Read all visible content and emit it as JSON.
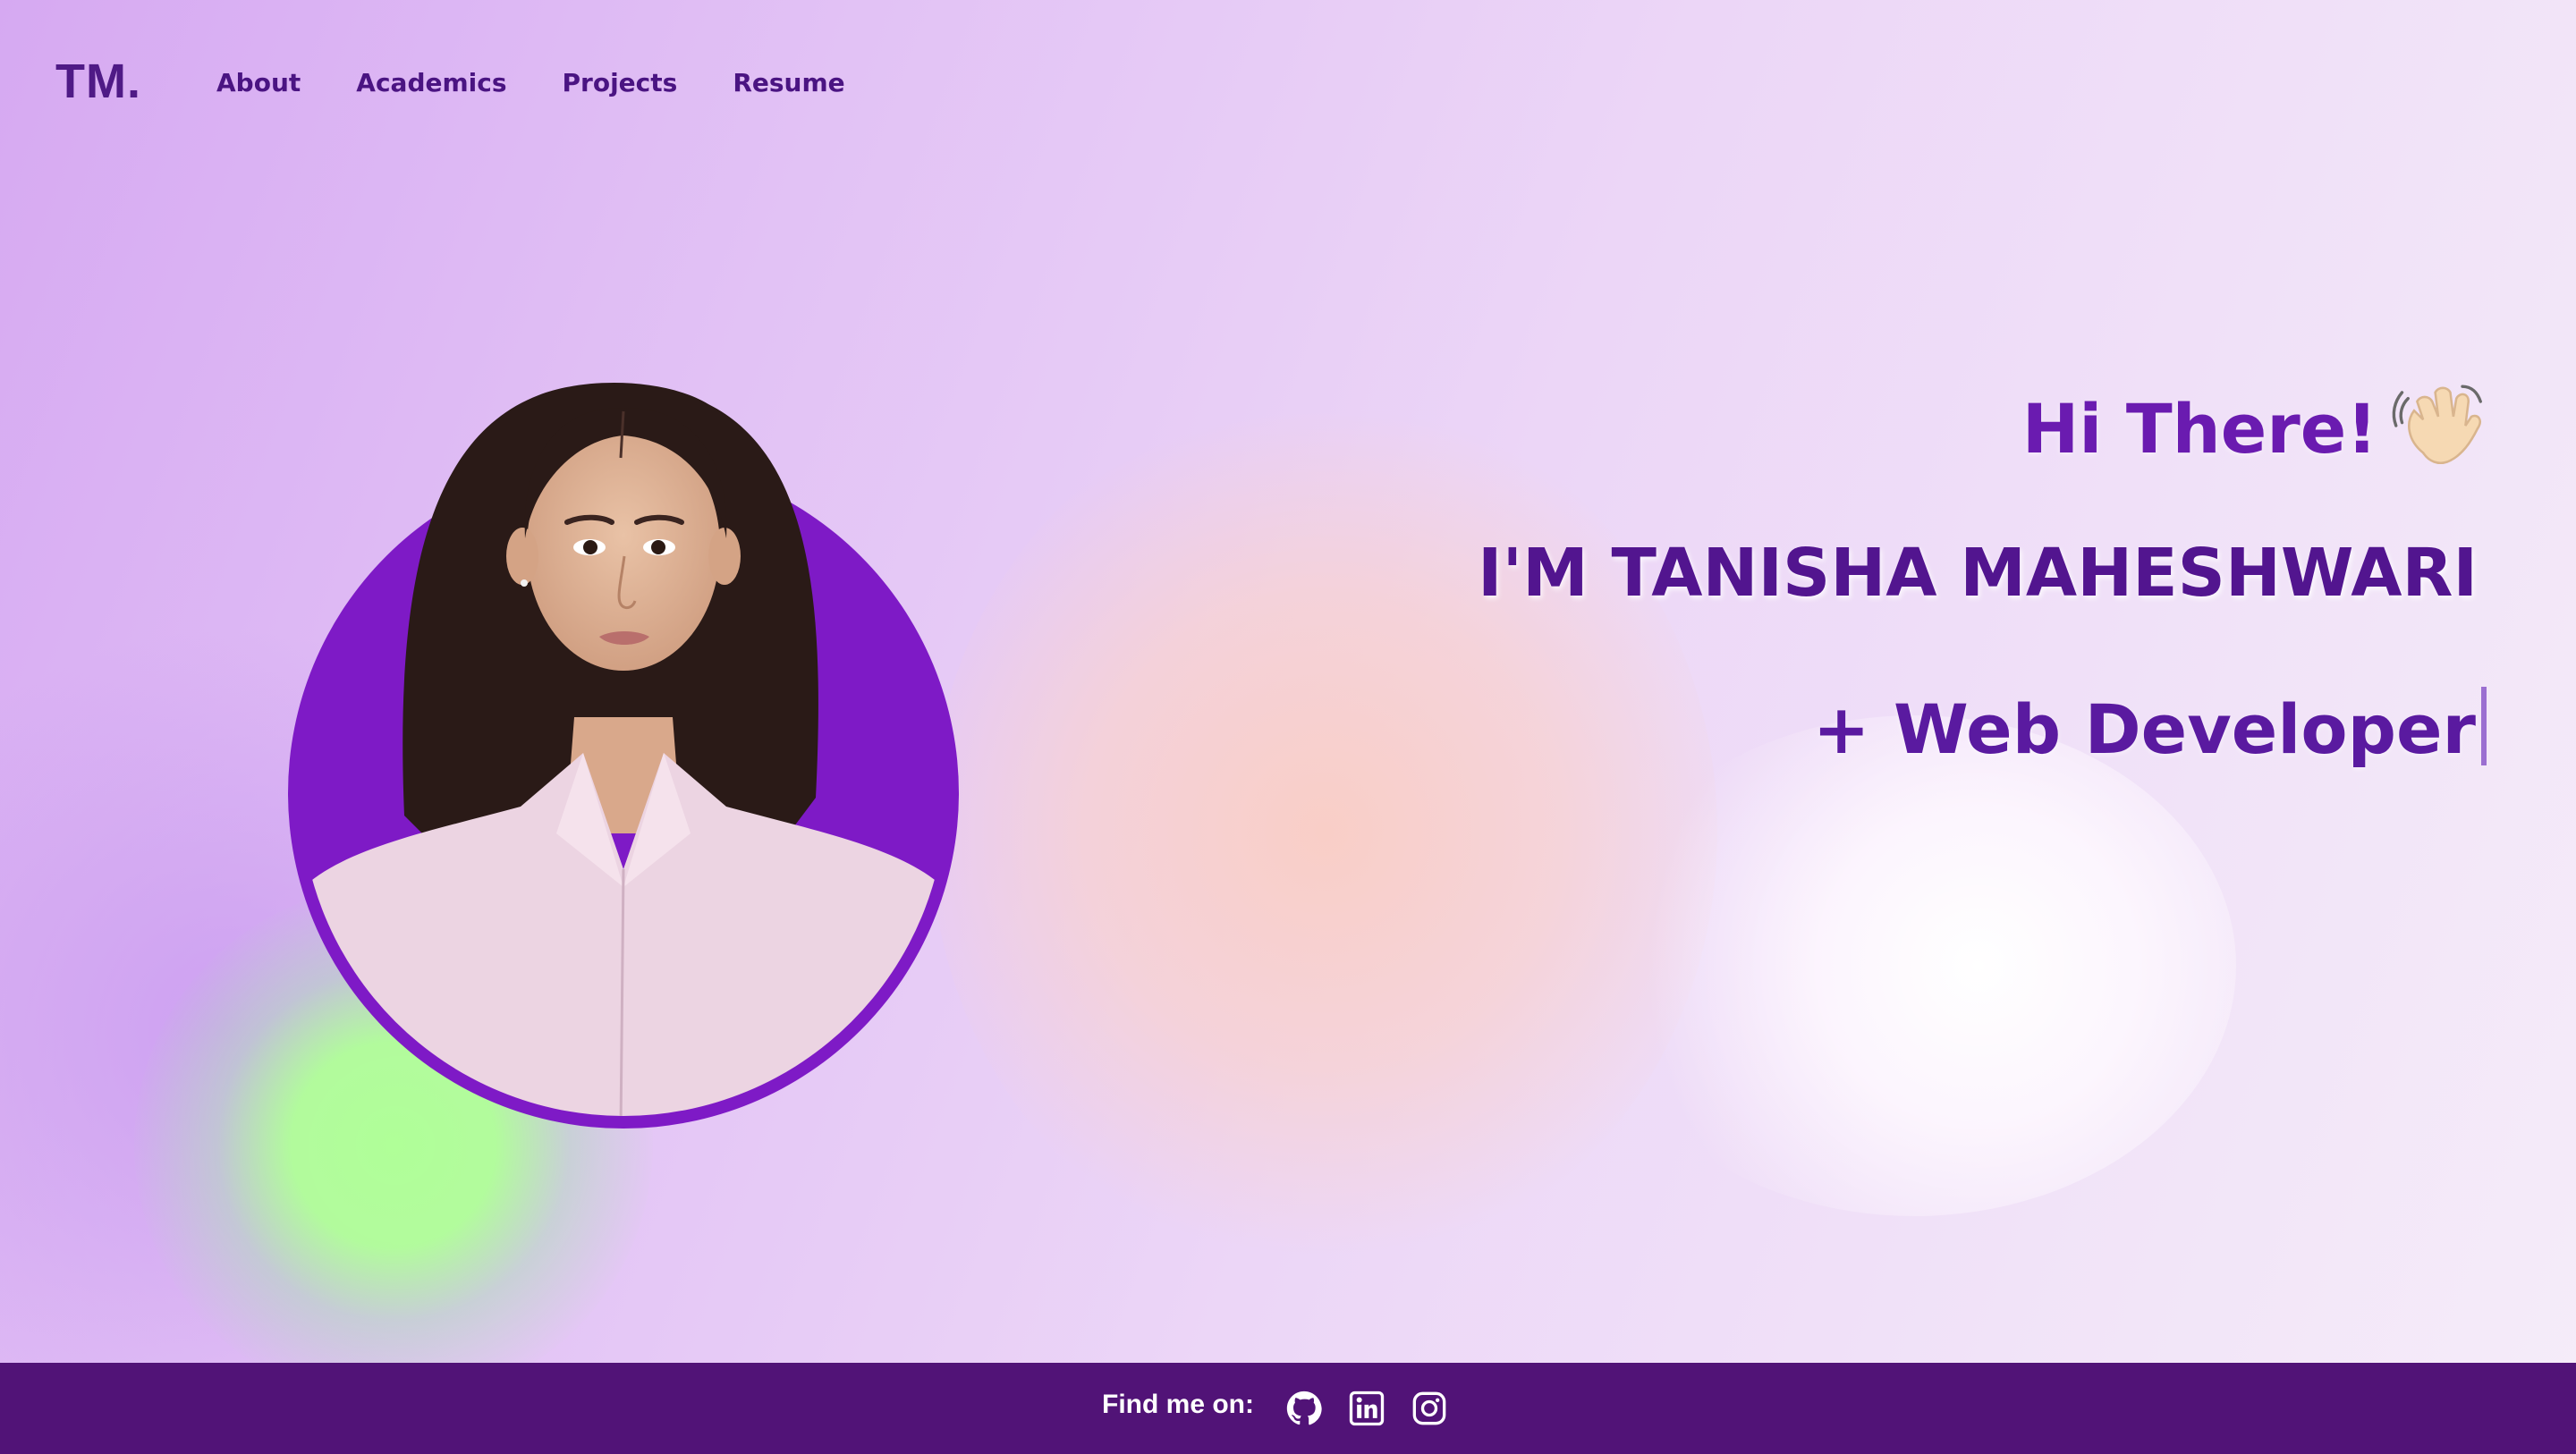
{
  "navbar": {
    "logo": "TM.",
    "links": [
      {
        "label": "About"
      },
      {
        "label": "Academics"
      },
      {
        "label": "Projects"
      },
      {
        "label": "Resume"
      }
    ]
  },
  "hero": {
    "greeting": "Hi There!",
    "greeting_icon": "waving-hand-icon",
    "name": "I'M TANISHA MAHESHWARI",
    "role": "+ Web Developer"
  },
  "portrait": {
    "icon": "profile-photo",
    "ring_color": "#7e1ac6"
  },
  "footer": {
    "find_label": "Find me on:",
    "socials": [
      {
        "icon": "github-icon"
      },
      {
        "icon": "linkedin-icon"
      },
      {
        "icon": "instagram-icon"
      }
    ]
  },
  "colors": {
    "accent": "#6a1bb0",
    "footer_bg": "#511377",
    "green_blob": "#b0ff98",
    "peach_blob": "#face c4"
  }
}
